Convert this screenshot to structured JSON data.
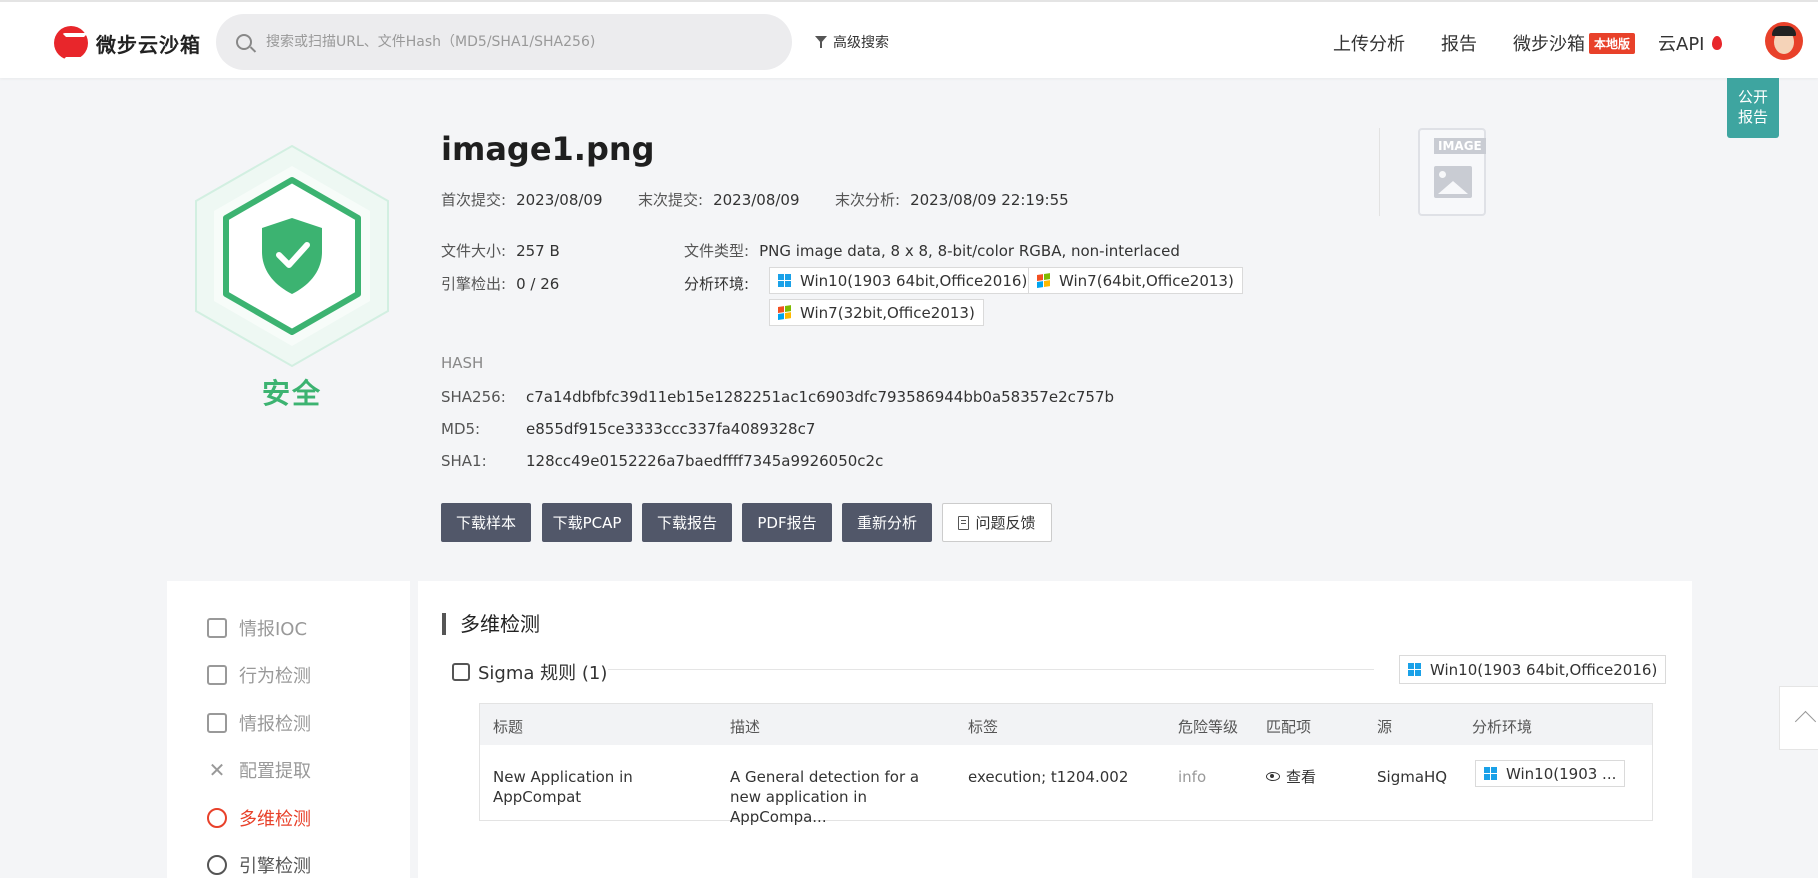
{
  "header": {
    "logo_text": "微步云沙箱",
    "search_placeholder": "搜索或扫描URL、文件Hash（MD5/SHA1/SHA256)",
    "advanced_search": "高级搜索",
    "nav": {
      "upload": "上传分析",
      "report": "报告",
      "sandbox": "微步沙箱",
      "local_badge": "本地版",
      "cloud_api": "云API"
    }
  },
  "public_report": [
    "公开",
    "报告"
  ],
  "verdict": "安全",
  "file": {
    "name": "image1.png",
    "first_submit_label": "首次提交:",
    "first_submit": "2023/08/09",
    "last_submit_label": "末次提交:",
    "last_submit": "2023/08/09",
    "last_analysis_label": "末次分析:",
    "last_analysis": "2023/08/09 22:19:55",
    "size_label": "文件大小:",
    "size": "257 B",
    "engine_label": "引擎检出:",
    "engine": "0 / 26",
    "type_label": "文件类型:",
    "type": "PNG image data, 8 x 8, 8-bit/color RGBA, non-interlaced",
    "env_label": "分析环境:",
    "envs": [
      "Win10(1903 64bit,Office2016)",
      "Win7(64bit,Office2013)",
      "Win7(32bit,Office2013)"
    ],
    "thumb_tag": "IMAGE"
  },
  "hash": {
    "heading": "HASH",
    "rows": [
      {
        "k": "SHA256:",
        "v": "c7a14dbfbfc39d11eb15e1282251ac1c6903dfc793586944bb0a58357e2c757b"
      },
      {
        "k": "MD5:",
        "v": "e855df915ce3333ccc337fa4089328c7"
      },
      {
        "k": "SHA1:",
        "v": "128cc49e0152226a7baedffff7345a9926050c2c"
      }
    ]
  },
  "actions": [
    "下载样本",
    "下载PCAP",
    "下载报告",
    "PDF报告",
    "重新分析",
    "问题反馈"
  ],
  "sidebar": [
    "情报IOC",
    "行为检测",
    "情报检测",
    "配置提取",
    "多维检测",
    "引擎检测"
  ],
  "section": {
    "title": "多维检测",
    "sigma_title": "Sigma 规则 (1)",
    "sigma_env": "Win10(1903 64bit,Office2016)"
  },
  "table": {
    "headers": [
      "标题",
      "描述",
      "标签",
      "危险等级",
      "匹配项",
      "源",
      "分析环境"
    ],
    "row": {
      "title": "New Application in AppCompat",
      "desc": "A General detection for a new application in AppCompa...",
      "tags": "execution; t1204.002",
      "level": "info",
      "match": "查看",
      "source": "SigmaHQ",
      "env": "Win10(1903 ..."
    }
  },
  "colors": {
    "safe": "#3cb371",
    "accent": "#e8412a",
    "button": "#515769",
    "public": "#3ea5a0"
  }
}
